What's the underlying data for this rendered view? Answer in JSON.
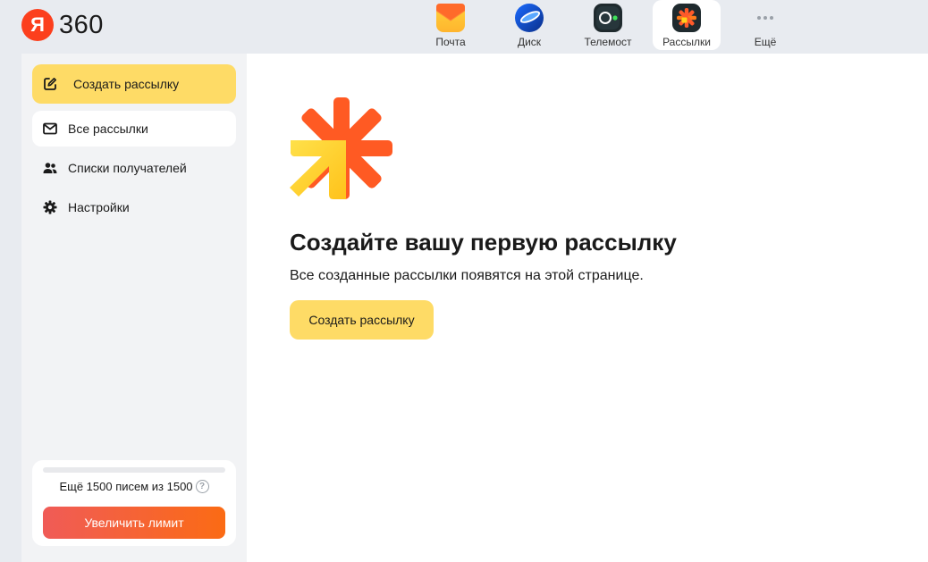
{
  "header": {
    "logo_letter": "Я",
    "logo_text": "360",
    "apps": [
      {
        "label": "Почта",
        "icon": "mail-envelope-icon",
        "active": false
      },
      {
        "label": "Диск",
        "icon": "disk-cloud-icon",
        "active": false
      },
      {
        "label": "Телемост",
        "icon": "telemost-camera-icon",
        "active": false
      },
      {
        "label": "Рассылки",
        "icon": "mailing-asterisk-icon",
        "active": true
      },
      {
        "label": "Ещё",
        "icon": "more-dots-icon",
        "active": false
      }
    ]
  },
  "sidebar": {
    "create_label": "Создать рассылку",
    "items": [
      {
        "label": "Все рассылки",
        "icon": "envelope-icon",
        "selected": true
      },
      {
        "label": "Списки получателей",
        "icon": "users-icon",
        "selected": false
      },
      {
        "label": "Настройки",
        "icon": "gear-icon",
        "selected": false
      }
    ],
    "limit": {
      "text": "Ещё 1500 писем из 1500",
      "help": "?",
      "used_fraction": 0,
      "button_label": "Увеличить лимит"
    }
  },
  "main": {
    "title": "Создайте вашу первую рассылку",
    "subtitle": "Все созданные рассылки появятся на этой странице.",
    "button_label": "Создать рассылку"
  },
  "colors": {
    "accent_yellow": "#fedb66",
    "brand_red": "#fc3f1d",
    "limit_gradient_start": "#f05b57",
    "limit_gradient_end": "#fb6b14",
    "sidebar_bg": "#f2f3f5",
    "page_bg": "#e8ebf0"
  }
}
